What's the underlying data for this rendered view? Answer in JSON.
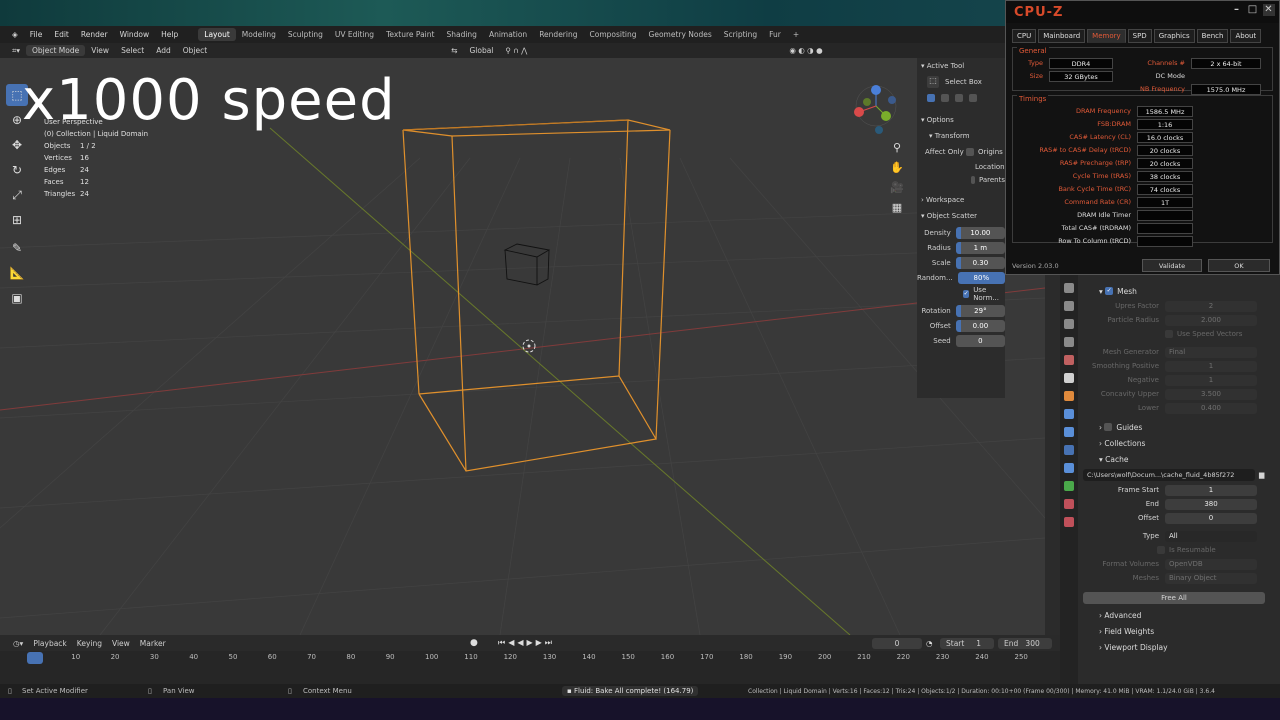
{
  "menubar": {
    "menus": [
      "File",
      "Edit",
      "Render",
      "Window",
      "Help"
    ],
    "workspaces": [
      "Layout",
      "Modeling",
      "Sculpting",
      "UV Editing",
      "Texture Paint",
      "Shading",
      "Animation",
      "Rendering",
      "Compositing",
      "Geometry Nodes",
      "Scripting",
      "Fur"
    ],
    "active_workspace": "Layout"
  },
  "header": {
    "mode": "Object Mode",
    "menus": [
      "View",
      "Select",
      "Add",
      "Object"
    ],
    "orientation": "Global"
  },
  "overlay_text": "x1000 speed",
  "viewport_info": {
    "line1": "User Perspective",
    "line2": "(0) Collection | Liquid Domain",
    "stats": [
      {
        "k": "Objects",
        "v": "1 / 2"
      },
      {
        "k": "Vertices",
        "v": "16"
      },
      {
        "k": "Edges",
        "v": "24"
      },
      {
        "k": "Faces",
        "v": "12"
      },
      {
        "k": "Triangles",
        "v": "24"
      }
    ]
  },
  "sidepanel": {
    "active_tool": "Active Tool",
    "select_box": "Select Box",
    "options": "Options",
    "transform": "Transform",
    "affect_only": "Affect Only",
    "affect_items": [
      "Origins",
      "Locations",
      "Parents"
    ],
    "workspace": "Workspace",
    "object_scatter": "Object Scatter",
    "fields": [
      {
        "label": "Density",
        "value": "10.00"
      },
      {
        "label": "Radius",
        "value": "1 m"
      },
      {
        "label": "Scale",
        "value": "0.30"
      },
      {
        "label": "Random...",
        "value": "80%"
      }
    ],
    "use_normals": "Use Norm...",
    "fields2": [
      {
        "label": "Rotation",
        "value": "29°"
      },
      {
        "label": "Offset",
        "value": "0.00"
      },
      {
        "label": "Seed",
        "value": "0"
      }
    ]
  },
  "cpuz": {
    "title": "CPU-Z",
    "tabs": [
      "CPU",
      "Mainboard",
      "Memory",
      "SPD",
      "Graphics",
      "Bench",
      "About"
    ],
    "active_tab": "Memory",
    "general_label": "General",
    "type_label": "Type",
    "type_value": "DDR4",
    "size_label": "Size",
    "size_value": "32 GBytes",
    "channels_label": "Channels #",
    "channels_value": "2 x 64-bit",
    "dc_label": "DC Mode",
    "dc_value": "",
    "nb_label": "NB Frequency",
    "nb_value": "1575.0 MHz",
    "timings_label": "Timings",
    "timings": [
      {
        "k": "DRAM Frequency",
        "v": "1586.5 MHz"
      },
      {
        "k": "FSB:DRAM",
        "v": "1:16"
      },
      {
        "k": "CAS# Latency (CL)",
        "v": "16.0 clocks"
      },
      {
        "k": "RAS# to CAS# Delay (tRCD)",
        "v": "20 clocks"
      },
      {
        "k": "RAS# Precharge (tRP)",
        "v": "20 clocks"
      },
      {
        "k": "Cycle Time (tRAS)",
        "v": "38 clocks"
      },
      {
        "k": "Bank Cycle Time (tRC)",
        "v": "74 clocks"
      },
      {
        "k": "Command Rate (CR)",
        "v": "1T"
      },
      {
        "k": "DRAM Idle Timer",
        "v": ""
      },
      {
        "k": "Total CAS# (tRDRAM)",
        "v": ""
      },
      {
        "k": "Row To Column (tRCD)",
        "v": ""
      }
    ],
    "version": "Version 2.03.0",
    "validate": "Validate",
    "ok": "OK"
  },
  "properties": {
    "mesh": "Mesh",
    "rows": [
      {
        "label": "Upres Factor",
        "value": "2"
      },
      {
        "label": "Particle Radius",
        "value": "2.000"
      }
    ],
    "use_speed_vectors": "Use Speed Vectors",
    "rows2": [
      {
        "label": "Mesh Generator",
        "value": "Final"
      },
      {
        "label": "Smoothing Positive",
        "value": "1"
      },
      {
        "label": "Negative",
        "value": "1"
      },
      {
        "label": "Concavity Upper",
        "value": "3.500"
      },
      {
        "label": "Lower",
        "value": "0.400"
      }
    ],
    "guides": "Guides",
    "collections": "Collections",
    "cache": "Cache",
    "cache_path": "C:\\Users\\wolf\\Docum...\\cache_fluid_4b85f272",
    "frame_start_label": "Frame Start",
    "frame_start": "1",
    "end_label": "End",
    "end": "380",
    "offset_label": "Offset",
    "offset": "0",
    "type_label": "Type",
    "type_value": "All",
    "is_resumable": "Is Resumable",
    "format_volumes_label": "Format Volumes",
    "format_volumes": "OpenVDB",
    "meshes_label": "Meshes",
    "meshes": "Binary Object",
    "free_all": "Free All",
    "advanced": "Advanced",
    "field_weights": "Field Weights",
    "viewport_display": "Viewport Display"
  },
  "timeline": {
    "menus": [
      "Playback",
      "Keying",
      "View",
      "Marker"
    ],
    "current_frame": "0",
    "start_label": "Start",
    "start": "1",
    "end_label": "End",
    "end": "300",
    "ticks": [
      "0",
      "10",
      "20",
      "30",
      "40",
      "50",
      "60",
      "70",
      "80",
      "90",
      "100",
      "110",
      "120",
      "130",
      "140",
      "150",
      "160",
      "170",
      "180",
      "190",
      "200",
      "210",
      "220",
      "230",
      "240",
      "250"
    ]
  },
  "status": {
    "left": "Set Active Modifier",
    "pan": "Pan View",
    "context": "Context Menu",
    "message": "Fluid: Bake All complete! (164.79)",
    "right": "Collection | Liquid Domain | Verts:16 | Faces:12 | Tris:24 | Objects:1/2 | Duration: 00:10+00 (Frame 00/300) | Memory: 41.0 MiB | VRAM: 1.1/24.0 GiB | 3.6.4"
  }
}
